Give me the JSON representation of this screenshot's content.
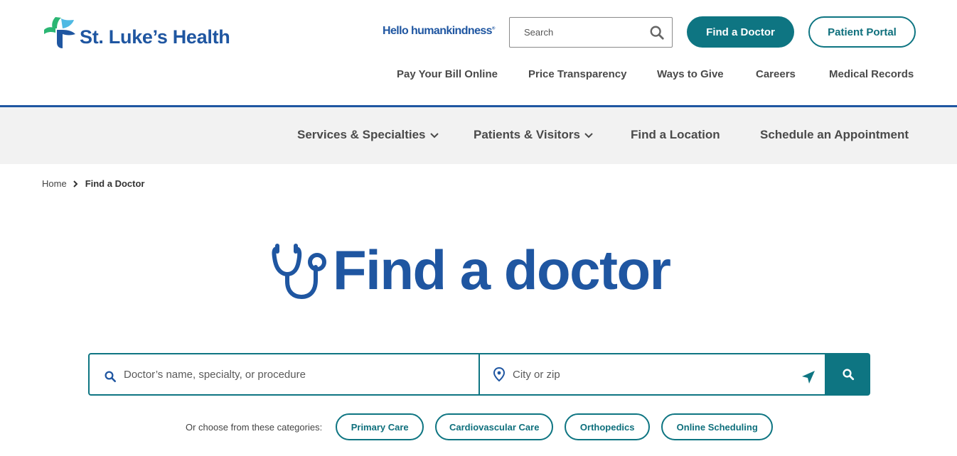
{
  "brand": {
    "name": "St. Luke’s Health",
    "tagline": "Hello humankindness",
    "tagline_mark": "®",
    "colors": {
      "blue": "#1f56a1",
      "teal": "#0e7582",
      "light_teal": "#4fb9e3",
      "green": "#2bb673"
    }
  },
  "header": {
    "search_placeholder": "Search",
    "find_doctor_label": "Find a Doctor",
    "patient_portal_label": "Patient Portal",
    "utility_links": [
      "Pay Your Bill Online",
      "Price Transparency",
      "Ways to Give",
      "Careers",
      "Medical Records"
    ]
  },
  "main_nav": {
    "items": [
      {
        "label": "Services & Specialties",
        "has_dropdown": true
      },
      {
        "label": "Patients & Visitors",
        "has_dropdown": true
      },
      {
        "label": "Find a Location",
        "has_dropdown": false
      },
      {
        "label": "Schedule an Appointment",
        "has_dropdown": false
      }
    ]
  },
  "breadcrumb": {
    "home": "Home",
    "current": "Find a Doctor"
  },
  "hero": {
    "title": "Find a doctor",
    "icon": "stethoscope-icon"
  },
  "search": {
    "doctor_placeholder": "Doctor’s name, specialty, or procedure",
    "location_placeholder": "City or zip"
  },
  "categories": {
    "label": "Or choose from these categories:",
    "chips": [
      "Primary Care",
      "Cardiovascular Care",
      "Orthopedics",
      "Online Scheduling"
    ]
  }
}
